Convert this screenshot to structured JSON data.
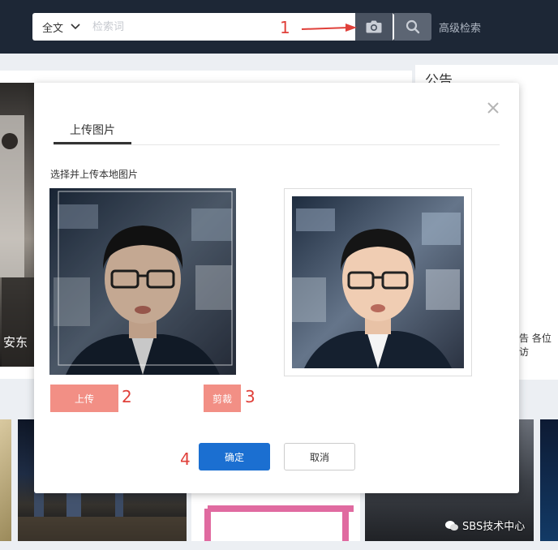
{
  "header": {
    "scope": "全文",
    "search_placeholder": "检索词",
    "advanced_search": "高级检索"
  },
  "annotations": {
    "a1": "1",
    "a2": "2",
    "a3": "3",
    "a4": "4"
  },
  "background": {
    "notice_title": "公告",
    "photo_caption": "安东",
    "notice_snippet": "告 各位访",
    "watermark": "SBS技术中心"
  },
  "modal": {
    "tab_upload": "上传图片",
    "section_label": "选择并上传本地图片",
    "upload_button": "上传",
    "crop_button": "剪裁",
    "confirm_button": "确定",
    "cancel_button": "取消"
  },
  "icons": {
    "camera": "camera-icon",
    "search": "search-icon",
    "close": "close-icon",
    "chevron": "chevron-down-icon"
  },
  "colors": {
    "header_bg": "#1d2736",
    "primary": "#1b6fd1",
    "pink_button": "#f28f85",
    "annotation_red": "#e0403a"
  }
}
